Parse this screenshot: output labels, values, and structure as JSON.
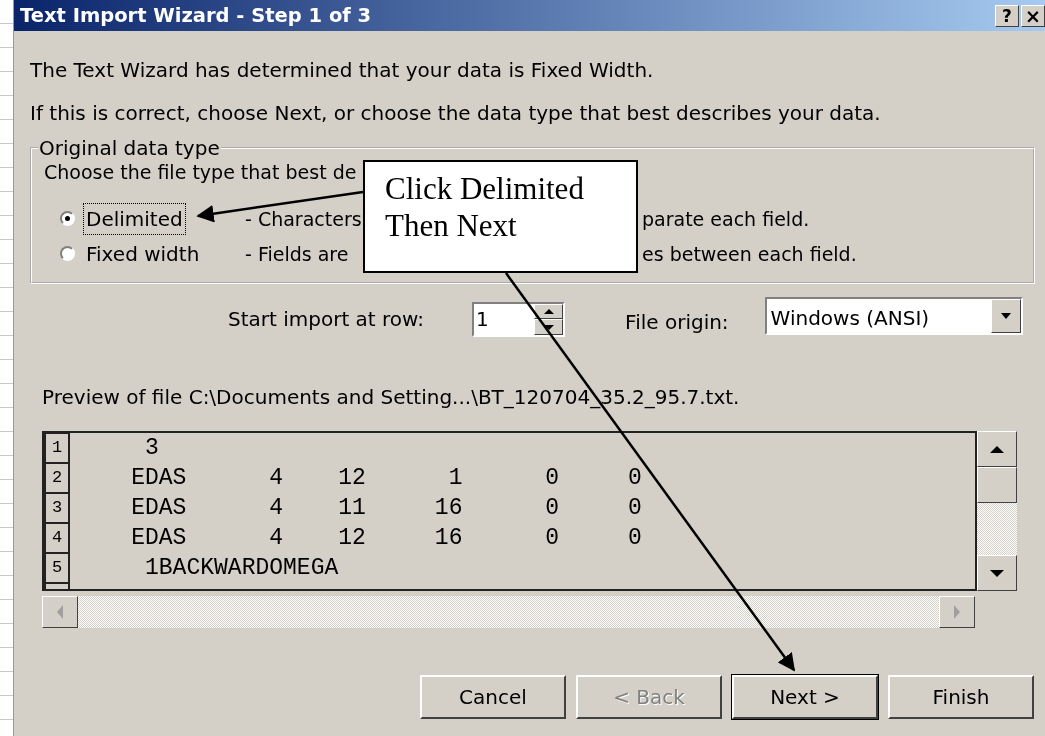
{
  "window": {
    "title": "Text Import Wizard - Step 1 of 3",
    "controls": [
      {
        "kind": "help",
        "label": "?"
      },
      {
        "kind": "close",
        "label": "×"
      }
    ]
  },
  "intro": [
    "The Text Wizard has determined that your data is Fixed Width.",
    "If this is correct, choose Next, or choose the data type that best describes your data."
  ],
  "group": {
    "title": "Original data type",
    "prompt": "Choose the file type that best de",
    "options": [
      {
        "label": "Delimited",
        "selected": true,
        "focused": true,
        "description": [
          "- Characters",
          "parate each field."
        ]
      },
      {
        "label": "Fixed width",
        "selected": false,
        "focused": false,
        "description": [
          "- Fields are",
          "es between each field."
        ]
      }
    ]
  },
  "start_row": {
    "label": "Start import at row:",
    "value": "1"
  },
  "file_origin": {
    "label": "File origin:",
    "value": "Windows (ANSI)"
  },
  "preview": {
    "label": "Preview of file C:\\Documents and Setting...\\BT_120704_35.2_95.7.txt.",
    "rows": [
      {
        "number": "1",
        "text": "     3"
      },
      {
        "number": "2",
        "text": "    EDAS      4    12      1      0     0"
      },
      {
        "number": "3",
        "text": "    EDAS      4    11     16      0     0"
      },
      {
        "number": "4",
        "text": "    EDAS      4    12     16      0     0"
      },
      {
        "number": "5",
        "text": "     1BACKWARDOMEGA"
      }
    ]
  },
  "buttons": [
    {
      "label": "Cancel",
      "disabled": false,
      "default": false
    },
    {
      "label": "< Back",
      "disabled": true,
      "default": false
    },
    {
      "label": "Next >",
      "disabled": false,
      "default": true
    },
    {
      "label": "Finish",
      "disabled": false,
      "default": false
    }
  ],
  "callout": {
    "lines": [
      "Click Delimited",
      "Then Next"
    ]
  }
}
